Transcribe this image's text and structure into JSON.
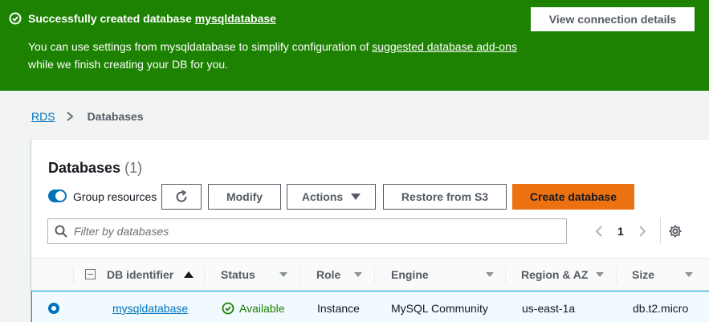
{
  "flash": {
    "title_prefix": "Successfully created database ",
    "title_db": "mysqldatabase",
    "body_prefix": "You can use settings from mysqldatabase to simplify configuration of ",
    "body_link": "suggested database add-ons",
    "body_suffix": " while we finish creating your DB for you.",
    "view_button": "View connection details"
  },
  "breadcrumb": {
    "root": "RDS",
    "current": "Databases"
  },
  "panel": {
    "title": "Databases",
    "count": "(1)",
    "group_toggle_label": "Group resources",
    "group_toggle_on": true,
    "buttons": {
      "modify": "Modify",
      "actions": "Actions",
      "restore": "Restore from S3",
      "create": "Create database"
    },
    "filter_placeholder": "Filter by databases",
    "page": "1"
  },
  "table": {
    "columns": [
      "DB identifier",
      "Status",
      "Role",
      "Engine",
      "Region & AZ",
      "Size"
    ],
    "rows": [
      {
        "identifier": "mysqldatabase",
        "status": "Available",
        "role": "Instance",
        "engine": "MySQL Community",
        "region": "us-east-1a",
        "size": "db.t2.micro"
      }
    ]
  },
  "colors": {
    "success": "#1d8102",
    "link": "#0073bb",
    "primary": "#ec7211"
  }
}
